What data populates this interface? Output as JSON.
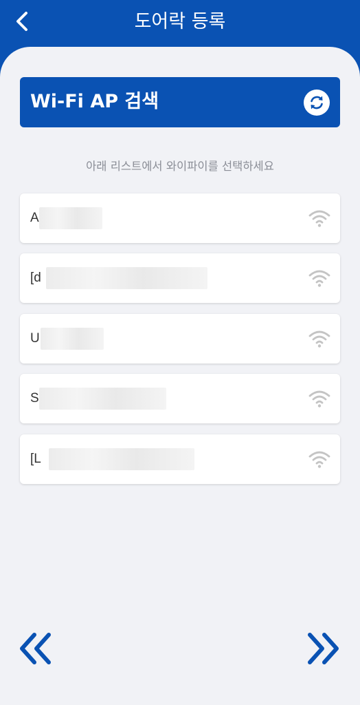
{
  "header": {
    "title": "도어락 등록",
    "back_icon": "chevron-left-icon"
  },
  "search": {
    "label": "Wi-Fi AP 검색",
    "refresh_icon": "refresh-icon"
  },
  "hint": "아래 리스트에서 와이파이를 선택하세요",
  "wifi_list": [
    {
      "name": "A"
    },
    {
      "name": "[d"
    },
    {
      "name": "U"
    },
    {
      "name": "S"
    },
    {
      "name": "[L"
    }
  ],
  "navigation": {
    "prev_icon": "double-chevron-left-icon",
    "next_icon": "double-chevron-right-icon"
  },
  "colors": {
    "brand": "#0a52b3",
    "background": "#f1f2f6",
    "hint_text": "#8a8d96",
    "wifi_icon": "#c4c4c4"
  }
}
